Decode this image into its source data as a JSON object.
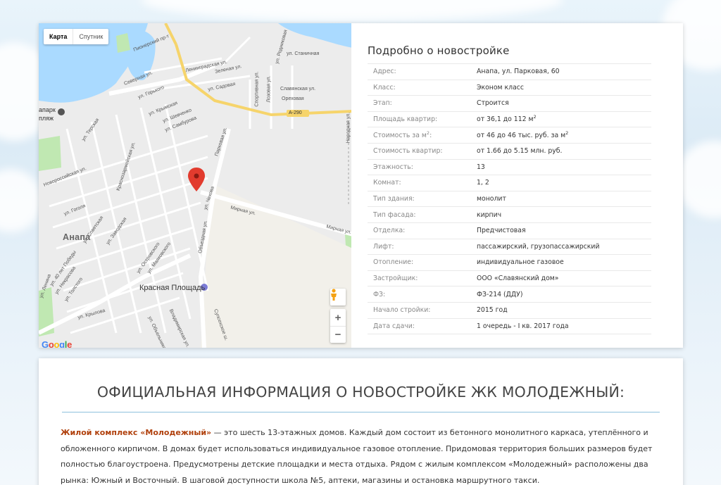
{
  "map": {
    "type_buttons": [
      "Карта",
      "Спутник"
    ],
    "labels": {
      "anapa": "Анапа",
      "red_square": "Красная Площадь",
      "highway": "А-290",
      "park": "апарк",
      "beach": "пляж",
      "lenin": "ул. Ленина",
      "pionersky": "Пионерский пр-т",
      "parkovaya": "Парковая ул.",
      "mirnaya": "Мирная ул.",
      "mirnaya2": "Мирная ул.",
      "chekhova": "ул. Чехова",
      "obezdnaya": "Объездная ул.",
      "severnaya": "Северная ул.",
      "gorkogo": "ул. Горького",
      "krymskaya": "ул. Крымская",
      "shevchenko": "ул. Шевченко",
      "samburova": "ул. Самбурова",
      "terskaya": "ул. Терская",
      "leningradskaya": "Ленинградская ул.",
      "zelenaya": "Зеленая ул.",
      "sadovaya": "ул. Садовая",
      "sportivnaya": "Спортивная ул.",
      "pozovaya": "Лозовая ул.",
      "stanichnaya": "ул. Станичная",
      "slavyanskaya": "Славянская ул.",
      "orekhovaya": "Ореховая",
      "rodnikovaya": "ул. Родниковая",
      "narodnaya": "Народная ул.",
      "sovetskaya": "ул. Советская",
      "gogolya": "ул. Гоголя",
      "zavodskaya": "ул. Заводская",
      "ostrovskogo": "ул. Островского",
      "mayakovskogo": "ул. Маяковского",
      "tolstogo": "ул. Толстого",
      "nekrasova": "ул. Некрасова",
      "krylova": "ул. Крылова",
      "pobedy": "ул. 40 лет Победы",
      "novorossiyskaya": "Новороссийская ул.",
      "krasnoarmeyskaya": "Краснозармейская ул.",
      "kirova": "ул. Кирова",
      "supsekh": "Супсехское ш.",
      "vladimirskaya": "Владимирская ул.",
      "obelnikova": "ул. Объельникова"
    },
    "zoom_in": "+",
    "zoom_out": "−",
    "google": [
      "G",
      "o",
      "o",
      "g",
      "l",
      "e"
    ],
    "google_colors": [
      "#4285f4",
      "#ea4335",
      "#fbbc05",
      "#4285f4",
      "#34a853",
      "#ea4335"
    ]
  },
  "details": {
    "title": "Подробно о новостройке",
    "rows": [
      {
        "key": "Адрес:",
        "value": "Анапа, ул. Парковая, 60"
      },
      {
        "key": "Класс:",
        "value": "Эконом класс"
      },
      {
        "key": "Этап:",
        "value": "Строится"
      },
      {
        "key": "Площадь квартир:",
        "value": "от 36,1 до 112 м",
        "value_sup": "2"
      },
      {
        "key": "Стоимость за м",
        "key_sup": "2",
        "key_tail": ":",
        "value": "от 46 до 46 тыс. руб. за м",
        "value_sup": "2"
      },
      {
        "key": "Стоимость квартир:",
        "value": "от 1.66 до 5.15 млн. руб."
      },
      {
        "key": "Этажность:",
        "value": "13"
      },
      {
        "key": "Комнат:",
        "value": "1, 2"
      },
      {
        "key": "Тип здания:",
        "value": "монолит"
      },
      {
        "key": "Тип фасада:",
        "value": "кирпич"
      },
      {
        "key": "Отделка:",
        "value": "Предчистовая"
      },
      {
        "key": "Лифт:",
        "value": "пассажирский, грузопассажирский"
      },
      {
        "key": "Отопление:",
        "value": "индивидуальное газовое"
      },
      {
        "key": "Застройщик:",
        "value": "ООО «Славянский дом»"
      },
      {
        "key": "ФЗ:",
        "value": "ФЗ-214 (ДДУ)"
      },
      {
        "key": "Начало стройки:",
        "value": "2015 год"
      },
      {
        "key": "Дата сдачи:",
        "value": "1 очередь - I кв. 2017 года"
      }
    ]
  },
  "info": {
    "heading": "ОФИЦИАЛЬНАЯ ИНФОРМАЦИЯ О НОВОСТРОЙКЕ ЖК МОЛОДЕЖНЫЙ:",
    "lead": "Жилой комплекс «Молодежный»",
    "text": " — это шесть 13-этажных домов. Каждый дом состоит из бетонного монолитного каркаса, утеплённого и обложенного кирпичом. В домах будет использоваться индивидуальное газовое отопление. Придомовая территория больших размеров будет полностью благоустроена. Предусмотрены детские площадки и места отдыха. Рядом с жилым комплексом «Молодежный» расположены два рынка: Южный и Восточный. В шаговой доступности школа №5, аптеки, магазины и остановка маршрутного такси."
  },
  "colors": {
    "accent_line": "#8dc0dd",
    "lead_text": "#b0400c",
    "water": "#aadaff",
    "park": "#c0e8b2",
    "highway": "#f6d46b",
    "pin": "#e23b2e"
  }
}
